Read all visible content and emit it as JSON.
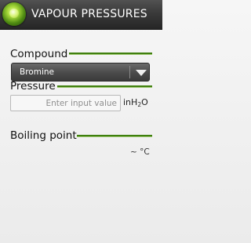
{
  "header": {
    "title": "VAPOUR PRESSURES",
    "logo_icon": "green-orb-icon"
  },
  "compound": {
    "label": "Compound",
    "selected": "Bromine",
    "arrow_icon": "triangle-down-icon"
  },
  "pressure": {
    "label": "Pressure",
    "placeholder": "Enter input value",
    "unit_prefix": "inH",
    "unit_sub": "2",
    "unit_suffix": "O"
  },
  "boiling_point": {
    "label": "Boiling point",
    "result": "~ °C"
  },
  "colors": {
    "accent_green": "#3f7f0e",
    "header_bg": "#3a3a3a"
  }
}
